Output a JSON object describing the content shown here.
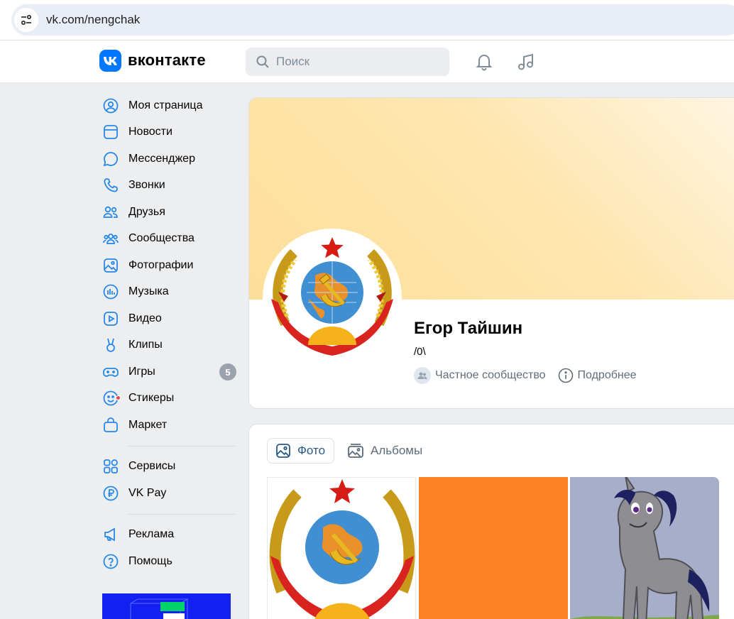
{
  "browser": {
    "url": "vk.com/nengchak"
  },
  "header": {
    "logo_text": "вконтакте",
    "search_placeholder": "Поиск",
    "icons": [
      "notifications-icon",
      "music-icon"
    ]
  },
  "sidebar": {
    "items": [
      {
        "label": "Моя страница",
        "icon": "profile-icon"
      },
      {
        "label": "Новости",
        "icon": "news-icon"
      },
      {
        "label": "Мессенджер",
        "icon": "messenger-icon"
      },
      {
        "label": "Звонки",
        "icon": "phone-icon"
      },
      {
        "label": "Друзья",
        "icon": "friends-icon"
      },
      {
        "label": "Сообщества",
        "icon": "communities-icon"
      },
      {
        "label": "Фотографии",
        "icon": "photos-icon"
      },
      {
        "label": "Музыка",
        "icon": "music-icon"
      },
      {
        "label": "Видео",
        "icon": "video-icon"
      },
      {
        "label": "Клипы",
        "icon": "clips-icon"
      },
      {
        "label": "Игры",
        "icon": "games-icon",
        "badge": "5"
      },
      {
        "label": "Стикеры",
        "icon": "stickers-icon"
      },
      {
        "label": "Маркет",
        "icon": "market-icon"
      }
    ],
    "items2": [
      {
        "label": "Сервисы",
        "icon": "services-icon"
      },
      {
        "label": "VK Pay",
        "icon": "vkpay-icon"
      }
    ],
    "items3": [
      {
        "label": "Реклама",
        "icon": "ads-icon"
      },
      {
        "label": "Помощь",
        "icon": "help-icon"
      }
    ]
  },
  "profile": {
    "name": "Егор Тайшин",
    "status": "/0\\",
    "privacy": "Частное сообщество",
    "details": "Подробнее"
  },
  "photos": {
    "tabs": [
      {
        "label": "Фото",
        "active": true
      },
      {
        "label": "Альбомы",
        "active": false
      }
    ]
  },
  "colors": {
    "accent": "#0077ff",
    "background": "#edeef0",
    "badge": "#99a2ad",
    "photo_orange": "#ff8126"
  }
}
